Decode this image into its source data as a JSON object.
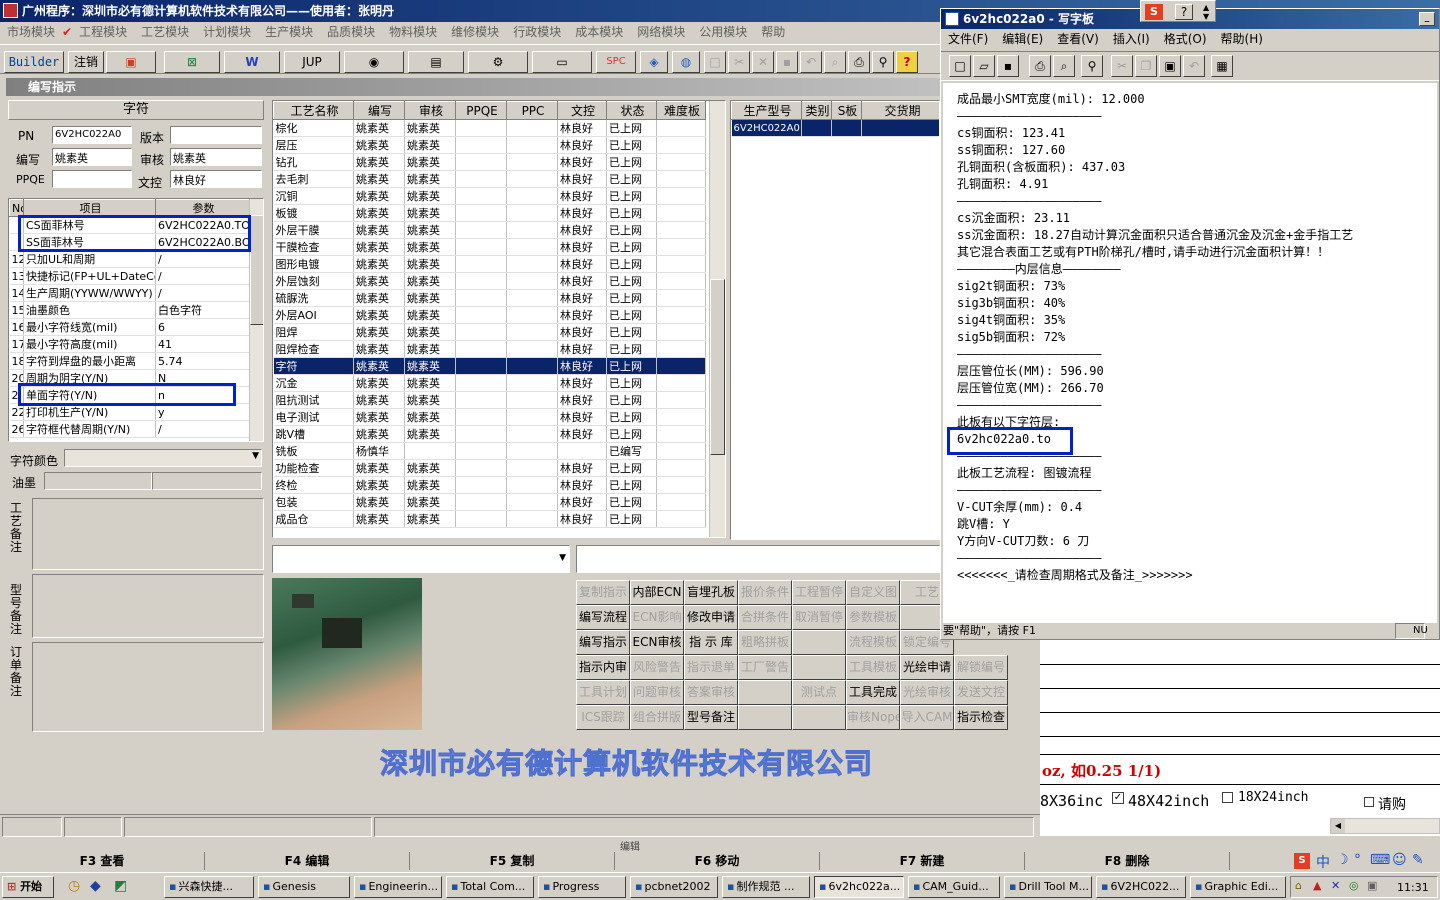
{
  "main_title": "广州程序：深圳市必有德计算机软件技术有限公司——使用者：张明丹",
  "menu": [
    "市场模块",
    "工程模块",
    "工艺模块",
    "计划模块",
    "生产模块",
    "品质模块",
    "物料模块",
    "维修模块",
    "行政模块",
    "成本模块",
    "网络模块",
    "公用模块",
    "帮助"
  ],
  "toolbar": {
    "builder": "Builder",
    "logout": "注销",
    "jup": "JUP",
    "spc": "SPC"
  },
  "subwindow_title": "编写指示",
  "zifu_header": "字符",
  "form": {
    "pn_label": "PN",
    "pn_value": "6V2HC022A0",
    "version_label": "版本",
    "version_value": "",
    "write_label": "编写",
    "write_value": "姚素英",
    "review_label": "审核",
    "review_value": "姚素英",
    "ppqe_label": "PPQE",
    "ppqe_value": "",
    "wenkong_label": "文控",
    "wenkong_value": "林良好"
  },
  "param_headers": [
    "No",
    "项目",
    "参数"
  ],
  "param_rows": [
    {
      "no": "",
      "item": "CS面菲林号",
      "param": "6V2HC022A0.TO"
    },
    {
      "no": "",
      "item": "SS面菲林号",
      "param": "6V2HC022A0.BO"
    },
    {
      "no": "12",
      "item": "只加UL和周期",
      "param": "/"
    },
    {
      "no": "13",
      "item": "快捷标记(FP+UL+DateCo",
      "param": "/"
    },
    {
      "no": "14",
      "item": "生产周期(YYWW/WWYY)",
      "param": "/"
    },
    {
      "no": "15",
      "item": "油墨颜色",
      "param": "白色字符"
    },
    {
      "no": "16",
      "item": "最小字符线宽(mil)",
      "param": "6"
    },
    {
      "no": "17",
      "item": "最小字符高度(mil)",
      "param": "41"
    },
    {
      "no": "18",
      "item": "字符到焊盘的最小距离",
      "param": "5.74"
    },
    {
      "no": "20",
      "item": "周期为阴字(Y/N)",
      "param": "N"
    },
    {
      "no": "2",
      "item": "单面字符(Y/N)",
      "param": "n"
    },
    {
      "no": "22",
      "item": "打印机生产(Y/N)",
      "param": "y"
    },
    {
      "no": "26",
      "item": "字符框代替周期(Y/N)",
      "param": "/"
    }
  ],
  "color_label": "字符颜色",
  "ink_label": "油墨",
  "remark_labels": [
    "工艺备注",
    "型号备注",
    "订单备注"
  ],
  "process_headers": [
    "工艺名称",
    "编写",
    "审核",
    "PPQE",
    "PPC",
    "文控",
    "状态",
    "难度板"
  ],
  "process_rows": [
    [
      "棕化",
      "姚素英",
      "姚素英",
      "",
      "",
      "林良好",
      "已上网"
    ],
    [
      "层压",
      "姚素英",
      "姚素英",
      "",
      "",
      "林良好",
      "已上网"
    ],
    [
      "钻孔",
      "姚素英",
      "姚素英",
      "",
      "",
      "林良好",
      "已上网"
    ],
    [
      "去毛刺",
      "姚素英",
      "姚素英",
      "",
      "",
      "林良好",
      "已上网"
    ],
    [
      "沉铜",
      "姚素英",
      "姚素英",
      "",
      "",
      "林良好",
      "已上网"
    ],
    [
      "板镀",
      "姚素英",
      "姚素英",
      "",
      "",
      "林良好",
      "已上网"
    ],
    [
      "外层干膜",
      "姚素英",
      "姚素英",
      "",
      "",
      "林良好",
      "已上网"
    ],
    [
      "干膜检查",
      "姚素英",
      "姚素英",
      "",
      "",
      "林良好",
      "已上网"
    ],
    [
      "图形电镀",
      "姚素英",
      "姚素英",
      "",
      "",
      "林良好",
      "已上网"
    ],
    [
      "外层蚀刻",
      "姚素英",
      "姚素英",
      "",
      "",
      "林良好",
      "已上网"
    ],
    [
      "硫脲洗",
      "姚素英",
      "姚素英",
      "",
      "",
      "林良好",
      "已上网"
    ],
    [
      "外层AOI",
      "姚素英",
      "姚素英",
      "",
      "",
      "林良好",
      "已上网"
    ],
    [
      "阻焊",
      "姚素英",
      "姚素英",
      "",
      "",
      "林良好",
      "已上网"
    ],
    [
      "阻焊检查",
      "姚素英",
      "姚素英",
      "",
      "",
      "林良好",
      "已上网"
    ],
    [
      "字符",
      "姚素英",
      "姚素英",
      "",
      "",
      "林良好",
      "已上网"
    ],
    [
      "沉金",
      "姚素英",
      "姚素英",
      "",
      "",
      "林良好",
      "已上网"
    ],
    [
      "阻抗测试",
      "姚素英",
      "姚素英",
      "",
      "",
      "林良好",
      "已上网"
    ],
    [
      "电子测试",
      "姚素英",
      "姚素英",
      "",
      "",
      "林良好",
      "已上网"
    ],
    [
      "跳V槽",
      "姚素英",
      "姚素英",
      "",
      "",
      "林良好",
      "已上网"
    ],
    [
      "铣板",
      "杨慎华",
      "",
      "",
      "",
      "",
      "已编写"
    ],
    [
      "功能检查",
      "姚素英",
      "姚素英",
      "",
      "",
      "林良好",
      "已上网"
    ],
    [
      "终检",
      "姚素英",
      "姚素英",
      "",
      "",
      "林良好",
      "已上网"
    ],
    [
      "包装",
      "姚素英",
      "姚素英",
      "",
      "",
      "林良好",
      "已上网"
    ],
    [
      "成品仓",
      "姚素英",
      "姚素英",
      "",
      "",
      "林良好",
      "已上网"
    ]
  ],
  "model_headers": [
    "生产型号",
    "类别",
    "S板",
    "交货期"
  ],
  "model_rows": [
    [
      "6V2HC022A0",
      "",
      "",
      ""
    ]
  ],
  "action_buttons": [
    [
      "复制指示",
      "内部ECN",
      "盲埋孔板",
      "报价条件",
      "工程暂停",
      "自定义图",
      "工艺"
    ],
    [
      "编写流程",
      "ECN影响",
      "修改申请",
      "合拼条件",
      "取消暂停",
      "参数模板",
      ""
    ],
    [
      "编写指示",
      "ECN审核",
      "指 示 库",
      "粗略拼板",
      "",
      "流程模板",
      "锁定编号"
    ],
    [
      "指示内审",
      "风险警告",
      "指示退单",
      "工厂警告",
      "",
      "工具模板",
      "光绘申请",
      "解锁编号"
    ],
    [
      "工具计划",
      "问题审核",
      "答案审核",
      "",
      "测试点",
      "工具完成",
      "光绘审核",
      "发送文控"
    ],
    [
      "ICS跟踪",
      "组合拼版",
      "型号备注",
      "",
      "",
      "审核Nope",
      "导入CAM",
      "指示检查"
    ]
  ],
  "company_banner": "深圳市必有德计算机软件技术有限公司",
  "bg_partial_text": {
    "unit_hint": "oz, 如0.25 1/1)",
    "size1": "8X36inc",
    "size2": "48X42inch",
    "size3": "18X24inch",
    "print_label": "请购",
    "bottom_label": "编辑"
  },
  "fkeys": [
    "F3 查看",
    "F4 编辑",
    "F5 复制",
    "F6 移动",
    "F7 新建",
    "F8 删除"
  ],
  "wordpad": {
    "title": "6v2hc022a0 - 写字板",
    "menu": [
      "文件(F)",
      "编辑(E)",
      "查看(V)",
      "插入(I)",
      "格式(O)",
      "帮助(H)"
    ],
    "status": "要\"帮助\"，请按 F1",
    "status_right": "NU",
    "lines": [
      "成品最小SMT宽度(mil): 12.000",
      "————————————————————",
      "cs铜面积: 123.41",
      "ss铜面积: 127.60",
      "孔铜面积(含板面积): 437.03",
      "孔铜面积: 4.91",
      "————————————————————",
      "cs沉金面积: 23.11",
      "ss沉金面积: 18.27自动计算沉金面积只适合普通沉金及沉金+金手指工艺",
      "其它混合表面工艺或有PTH阶梯孔/槽时,请手动进行沉金面积计算！！",
      "————————内层信息————————",
      "sig2t铜面积: 73%",
      "sig3b铜面积: 40%",
      "sig4t铜面积: 35%",
      "sig5b铜面积: 72%",
      "————————————————————",
      "层压管位长(MM): 596.90",
      "层压管位宽(MM): 266.70",
      "————————————————————",
      "此板有以下字符层:",
      "6v2hc022a0.to",
      "————————————————————",
      "此板工艺流程: 图镀流程",
      "————————————————————",
      "V-CUT余厚(mm): 0.4",
      "跳V槽: Y",
      "Y方向V-CUT刀数: 6 刀",
      "————————————————————",
      "<<<<<<<_请检查周期格式及备注_>>>>>>>"
    ]
  },
  "taskbar": {
    "start": "开始",
    "items": [
      "兴森快捷...",
      "Genesis",
      "Engineerin...",
      "Total Com...",
      "Progress",
      "pcbnet2002",
      "制作规范 ...",
      "6v2hc022a...",
      "CAM_Guid...",
      "Drill Tool M...",
      "6V2HC022...",
      "Graphic Edi..."
    ],
    "clock": "11:31"
  },
  "colors": {
    "title_dark": "#0a246a",
    "title_light": "#3a6ea5",
    "highlight_box": "#0022cc",
    "select_row": "#0a246a",
    "banner_text": "#9ab0ee"
  }
}
